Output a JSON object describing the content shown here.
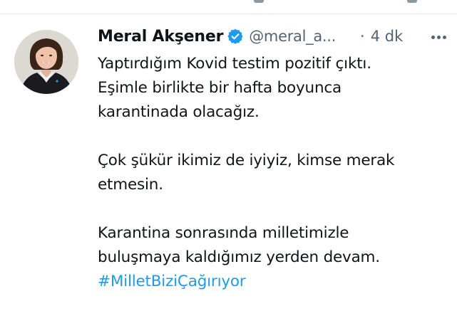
{
  "tweet": {
    "author_name": "Meral Akşener",
    "handle": "@meral_a...",
    "separator": "·",
    "time": "4 dk",
    "verified": true,
    "paragraphs": [
      [
        "Yaptırdığım Kovid testim pozitif çıktı.",
        "Eşimle birlikte bir hafta boyunca",
        "karantinada olacağız."
      ],
      [
        "Çok şükür ikimiz de iyiyiz, kimse merak",
        "etmesin."
      ],
      [
        "Karantina sonrasında milletimizle",
        "buluşmaya kaldığımız yerden devam."
      ]
    ],
    "hashtag": "#MilletBiziÇağırıyor"
  },
  "colors": {
    "text": "#0f1419",
    "secondary": "#536471",
    "link": "#1d9bf0",
    "verified_badge": "#1d9bf0"
  },
  "icons": {
    "verified": "verified-badge-icon",
    "more": "more-horizontal-icon",
    "avatar": "profile-photo"
  }
}
